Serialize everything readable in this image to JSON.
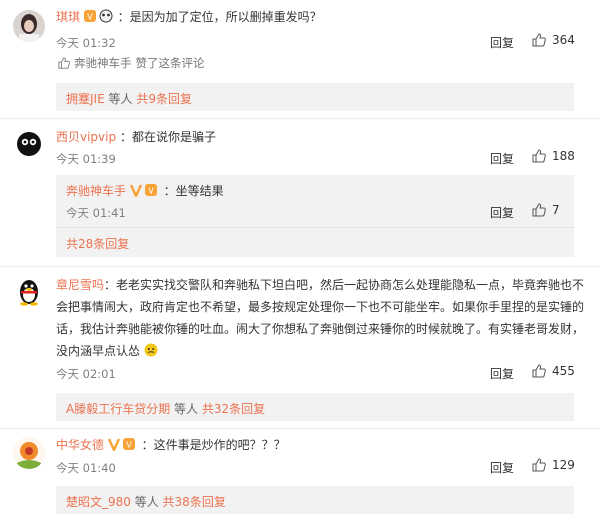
{
  "comments": [
    {
      "username": "琪琪",
      "text": "：是因为加了定位，所以删掉重发吗？",
      "time": "今天 01:32",
      "reply_label": "回复",
      "likes": "364",
      "liked_by_user": "奔驰神车手",
      "liked_by_text": "赞了这条评论",
      "replies_user": "拥蹇JIE",
      "replies_etc": " 等人 ",
      "replies_count": "共9条回复"
    },
    {
      "username": "西贝vipvip",
      "text": "：都在说你是骗子",
      "time": "今天 01:39",
      "reply_label": "回复",
      "likes": "188",
      "sub": {
        "username": "奔驰神车手",
        "text": "：坐等结果",
        "time": "今天 01:41",
        "reply_label": "回复",
        "likes": "7"
      },
      "replies_count": "共28条回复"
    },
    {
      "username": "章尼雪吗",
      "text": "：老老实实找交警队和奔驰私下坦白吧，然后一起协商怎么处理能隐私一点，毕竟奔驰也不会把事情闹大，政府肯定也不希望，最多按规定处理你一下也不可能坐牢。如果你手里捏的是实锤的话，我估计奔驰能被你锤的吐血。闹大了你想私了奔驰倒过来锤你的时候就晚了。有实锤老哥发财，没内涵早点认怂",
      "time": "今天 02:01",
      "reply_label": "回复",
      "likes": "455",
      "replies_user": "A滕毅工行车贷分期",
      "replies_etc": " 等人 ",
      "replies_count": "共32条回复"
    },
    {
      "username": "中华女德",
      "text": "：这件事是炒作的吧？？？",
      "time": "今天 01:40",
      "reply_label": "回复",
      "likes": "129",
      "replies_user": "楚昭文_980",
      "replies_etc": " 等人 ",
      "replies_count": "共38条回复"
    }
  ],
  "colors": {
    "accent": "#eb7350",
    "muted": "#808080",
    "box_bg": "#f2f2f2"
  }
}
